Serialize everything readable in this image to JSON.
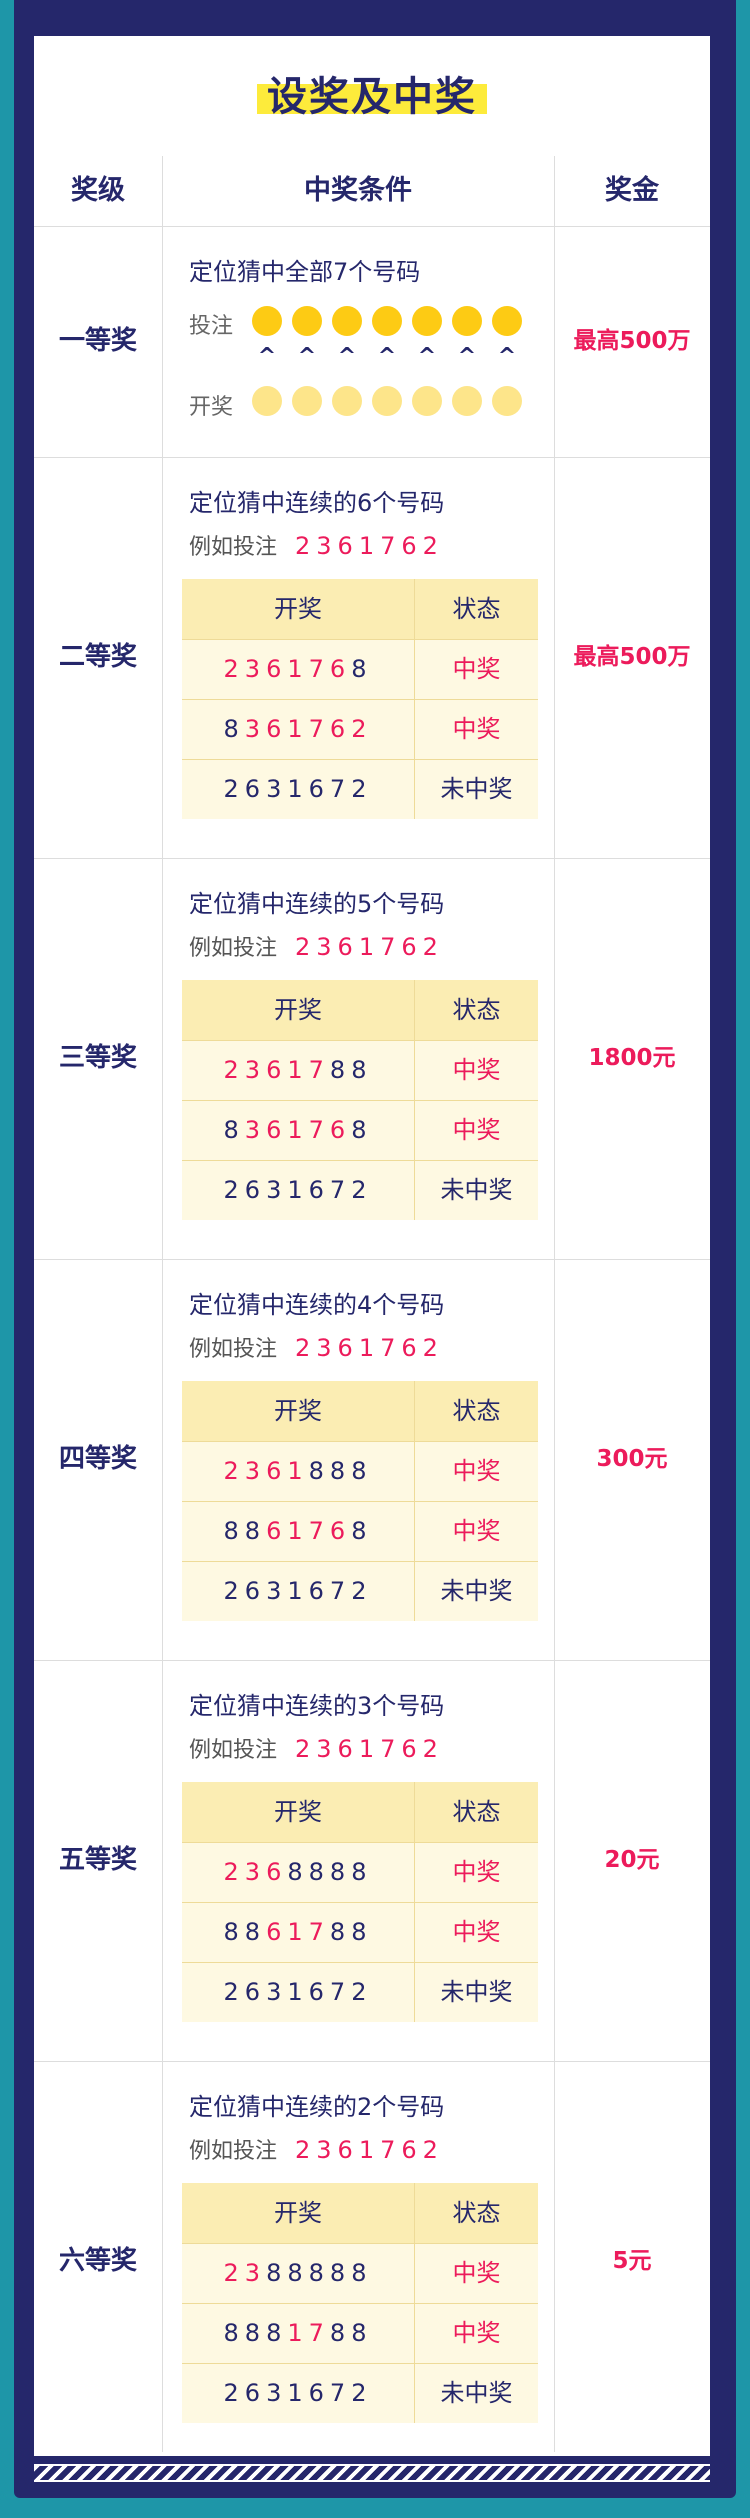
{
  "title": "设奖及中奖",
  "headers": {
    "level": "奖级",
    "condition": "中奖条件",
    "prize": "奖金"
  },
  "first": {
    "level": "一等奖",
    "condition": "定位猜中全部7个号码",
    "bet_label": "投注",
    "draw_label": "开奖",
    "caret": "^",
    "prize": "最高500万",
    "bet_color": "#fdcb14",
    "draw_color": "#fde58a"
  },
  "table_header": {
    "draw": "开奖",
    "status": "状态"
  },
  "example_label": "例如投注",
  "example_number": "2361762",
  "status": {
    "win": "中奖",
    "lose": "未中奖"
  },
  "tiers": [
    {
      "level": "二等奖",
      "condition": "定位猜中连续的6个号码",
      "prize": "最高500万",
      "rows": [
        {
          "digits": "2361768",
          "status": "中奖"
        },
        {
          "digits": "8361762",
          "status": "中奖"
        },
        {
          "digits": "2631672",
          "status": "未中奖"
        }
      ]
    },
    {
      "level": "三等奖",
      "condition": "定位猜中连续的5个号码",
      "prize": "1800元",
      "rows": [
        {
          "digits": "2361788",
          "status": "中奖"
        },
        {
          "digits": "8361768",
          "status": "中奖"
        },
        {
          "digits": "2631672",
          "status": "未中奖"
        }
      ]
    },
    {
      "level": "四等奖",
      "condition": "定位猜中连续的4个号码",
      "prize": "300元",
      "rows": [
        {
          "digits": "2361888",
          "status": "中奖"
        },
        {
          "digits": "8861768",
          "status": "中奖"
        },
        {
          "digits": "2631672",
          "status": "未中奖"
        }
      ]
    },
    {
      "level": "五等奖",
      "condition": "定位猜中连续的3个号码",
      "prize": "20元",
      "rows": [
        {
          "digits": "2368888",
          "status": "中奖"
        },
        {
          "digits": "8861788",
          "status": "中奖"
        },
        {
          "digits": "2631672",
          "status": "未中奖"
        }
      ]
    },
    {
      "level": "六等奖",
      "condition": "定位猜中连续的2个号码",
      "prize": "5元",
      "rows": [
        {
          "digits": "2388888",
          "status": "中奖"
        },
        {
          "digits": "8881788",
          "status": "中奖"
        },
        {
          "digits": "2631672",
          "status": "未中奖"
        }
      ]
    }
  ],
  "colors": {
    "accent": "#ec1b5b",
    "navy": "#25276b",
    "background": "#1e96a8",
    "highlight": "#fdeb3b"
  }
}
